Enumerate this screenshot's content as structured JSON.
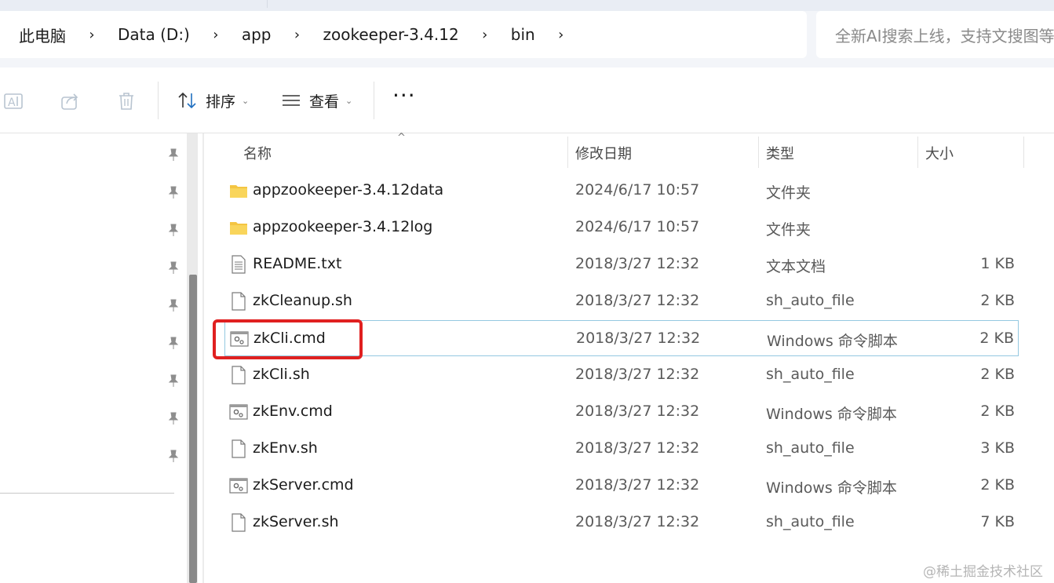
{
  "breadcrumb": [
    "此电脑",
    "Data (D:)",
    "app",
    "zookeeper-3.4.12",
    "bin"
  ],
  "search": {
    "placeholder": "全新AI搜索上线，支持文搜图等"
  },
  "toolbar": {
    "sort_label": "排序",
    "view_label": "查看"
  },
  "columns": {
    "name": "名称",
    "date": "修改日期",
    "type": "类型",
    "size": "大小"
  },
  "files": [
    {
      "name": "appzookeeper-3.4.12data",
      "date": "2024/6/17 10:57",
      "type": "文件夹",
      "size": "",
      "icon": "folder-icon"
    },
    {
      "name": "appzookeeper-3.4.12log",
      "date": "2024/6/17 10:57",
      "type": "文件夹",
      "size": "",
      "icon": "folder-icon"
    },
    {
      "name": "README.txt",
      "date": "2018/3/27 12:32",
      "type": "文本文档",
      "size": "1 KB",
      "icon": "text-file-icon"
    },
    {
      "name": "zkCleanup.sh",
      "date": "2018/3/27 12:32",
      "type": "sh_auto_file",
      "size": "2 KB",
      "icon": "blank-file-icon"
    },
    {
      "name": "zkCli.cmd",
      "date": "2018/3/27 12:32",
      "type": "Windows 命令脚本",
      "size": "2 KB",
      "icon": "cmd-script-icon",
      "selected": true
    },
    {
      "name": "zkCli.sh",
      "date": "2018/3/27 12:32",
      "type": "sh_auto_file",
      "size": "2 KB",
      "icon": "blank-file-icon"
    },
    {
      "name": "zkEnv.cmd",
      "date": "2018/3/27 12:32",
      "type": "Windows 命令脚本",
      "size": "2 KB",
      "icon": "cmd-script-icon"
    },
    {
      "name": "zkEnv.sh",
      "date": "2018/3/27 12:32",
      "type": "sh_auto_file",
      "size": "3 KB",
      "icon": "blank-file-icon"
    },
    {
      "name": "zkServer.cmd",
      "date": "2018/3/27 12:32",
      "type": "Windows 命令脚本",
      "size": "2 KB",
      "icon": "cmd-script-icon"
    },
    {
      "name": "zkServer.sh",
      "date": "2018/3/27 12:32",
      "type": "sh_auto_file",
      "size": "7 KB",
      "icon": "blank-file-icon"
    }
  ],
  "watermark": "@稀土掘金技术社区",
  "colors": {
    "highlight": "#e02020",
    "selection_border": "#94c8e0",
    "folder": "#f4c542"
  }
}
